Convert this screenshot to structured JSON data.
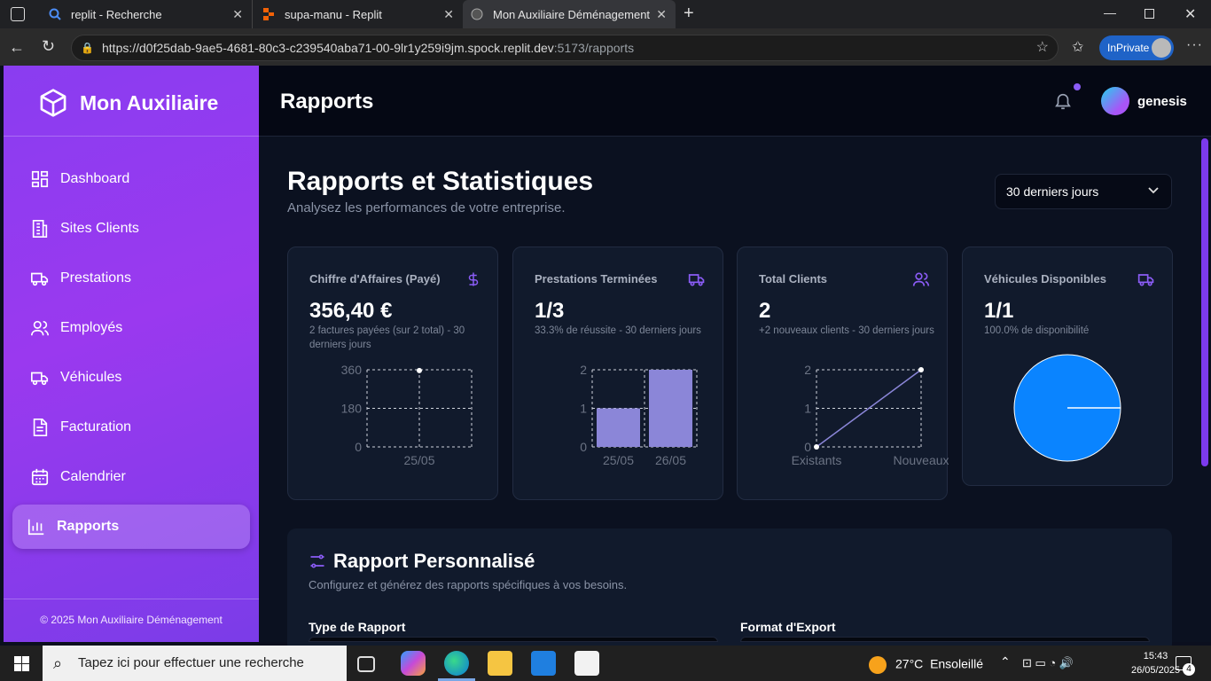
{
  "browser": {
    "tabs": [
      {
        "label": "replit - Recherche"
      },
      {
        "label": "supa-manu - Replit"
      },
      {
        "label": "Mon Auxiliaire Déménagement"
      }
    ],
    "url_main": "https://d0f25dab-9ae5-4681-80c3-c239540aba71-00-9lr1y259i9jm.spock.replit.dev",
    "url_rest": ":5173/rapports",
    "private_label": "InPrivate"
  },
  "sidebar": {
    "brand": "Mon Auxiliaire",
    "items": [
      {
        "label": "Dashboard",
        "icon": "grid-icon"
      },
      {
        "label": "Sites Clients",
        "icon": "building-icon"
      },
      {
        "label": "Prestations",
        "icon": "truck-icon"
      },
      {
        "label": "Employés",
        "icon": "users-icon"
      },
      {
        "label": "Véhicules",
        "icon": "truck-icon"
      },
      {
        "label": "Facturation",
        "icon": "file-icon"
      },
      {
        "label": "Calendrier",
        "icon": "calendar-icon"
      },
      {
        "label": "Rapports",
        "icon": "bar-chart-icon"
      }
    ],
    "footer": "© 2025 Mon Auxiliaire Déménagement"
  },
  "header": {
    "title": "Rapports",
    "user": "genesis"
  },
  "page": {
    "title": "Rapports et Statistiques",
    "subtitle": "Analysez les performances de votre entreprise.",
    "period": "30 derniers jours"
  },
  "cards": [
    {
      "title": "Chiffre d'Affaires (Payé)",
      "value": "356,40 €",
      "sub": "2 factures payées (sur 2 total) - 30 derniers jours",
      "icon": "dollar-icon"
    },
    {
      "title": "Prestations Terminées",
      "value": "1/3",
      "sub": "33.3% de réussite - 30 derniers jours",
      "icon": "truck-icon"
    },
    {
      "title": "Total Clients",
      "value": "2",
      "sub": "+2 nouveaux clients - 30 derniers jours",
      "icon": "users-icon"
    },
    {
      "title": "Véhicules Disponibles",
      "value": "1/1",
      "sub": "100.0% de disponibilité",
      "icon": "truck-icon"
    }
  ],
  "chart_data": [
    {
      "type": "line",
      "x": [
        "25/05"
      ],
      "values": [
        356.4
      ],
      "yticks": [
        "0",
        "180",
        "360"
      ],
      "ylim": [
        0,
        360
      ]
    },
    {
      "type": "bar",
      "categories": [
        "25/05",
        "26/05"
      ],
      "values": [
        1,
        2
      ],
      "yticks": [
        "0",
        "1",
        "2"
      ],
      "ylim": [
        0,
        2
      ]
    },
    {
      "type": "line",
      "categories": [
        "Existants",
        "Nouveaux"
      ],
      "values": [
        0,
        2
      ],
      "yticks": [
        "0",
        "1",
        "2"
      ],
      "ylim": [
        0,
        2
      ]
    },
    {
      "type": "pie",
      "values": [
        1
      ],
      "color": "#0a84ff"
    }
  ],
  "custom": {
    "title": "Rapport Personnalisé",
    "subtitle": "Configurez et générez des rapports spécifiques à vos besoins.",
    "type_label": "Type de Rapport",
    "format_label": "Format d'Export"
  },
  "taskbar": {
    "search_placeholder": "Tapez ici pour effectuer une recherche",
    "weather": "27°C",
    "weather_text": "Ensoleillé",
    "time": "15:43",
    "date": "26/05/2025",
    "notif_count": "4"
  },
  "colors": {
    "accent": "#8b5cf6",
    "bar": "#8b86d8",
    "pie": "#0a84ff"
  }
}
